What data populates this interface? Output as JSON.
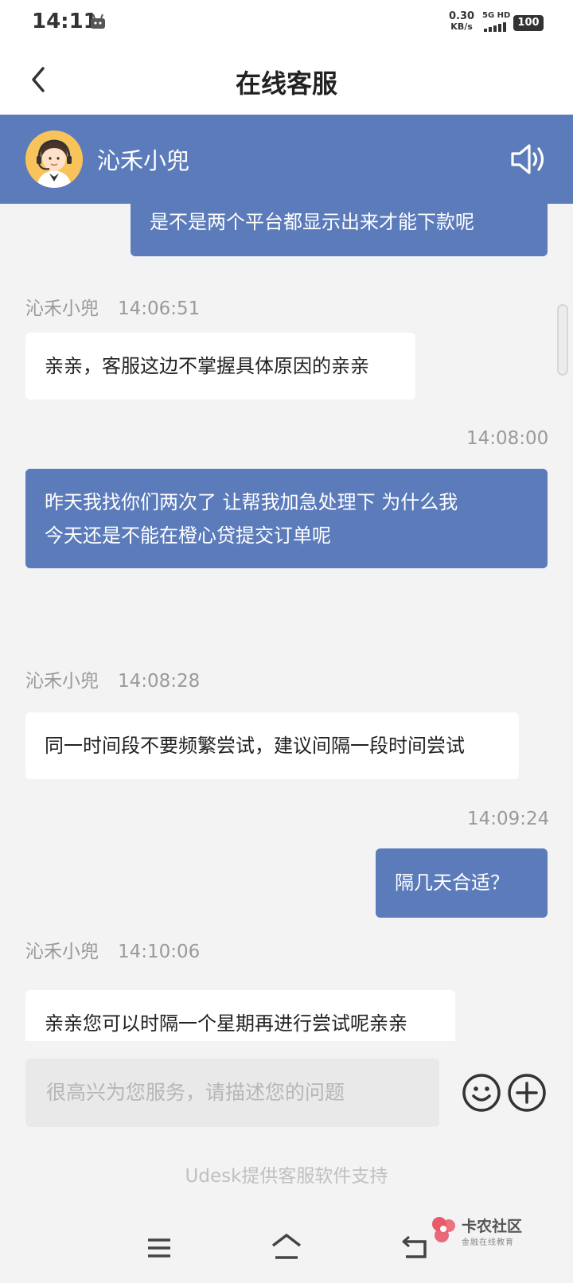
{
  "status_bar": {
    "time": "14:11",
    "net_speed": "0.30",
    "net_speed_unit": "KB/s",
    "network": "5G HD",
    "battery": "100"
  },
  "header": {
    "title": "在线客服"
  },
  "agent": {
    "name": "沁禾小兜"
  },
  "messages": {
    "m1": {
      "text": "是不是两个平台都显示出来才能下款呢"
    },
    "m2": {
      "sender": "沁禾小兜",
      "time": "14:06:51",
      "text": "亲亲，客服这边不掌握具体原因的亲亲"
    },
    "m3": {
      "time": "14:08:00",
      "line1": "昨天我找你们两次了 让帮我加急处理下 为什么我",
      "line2": "今天还是不能在橙心贷提交订单呢"
    },
    "m4": {
      "sender": "沁禾小兜",
      "time": "14:08:28",
      "text": "同一时间段不要频繁尝试，建议间隔一段时间尝试"
    },
    "m5": {
      "time": "14:09:24",
      "text": "隔几天合适？"
    },
    "m6": {
      "sender": "沁禾小兜",
      "time": "14:10:06",
      "text": "亲亲您可以时隔一个星期再进行尝试呢亲亲"
    }
  },
  "composer": {
    "placeholder": "很高兴为您服务，请描述您的问题",
    "powered_by": "Udesk提供客服软件支持"
  },
  "watermark": {
    "title": "卡农社区",
    "subtitle": "金融在线教育"
  },
  "colors": {
    "accent": "#5b7bbb",
    "background": "#f3f3f3"
  }
}
